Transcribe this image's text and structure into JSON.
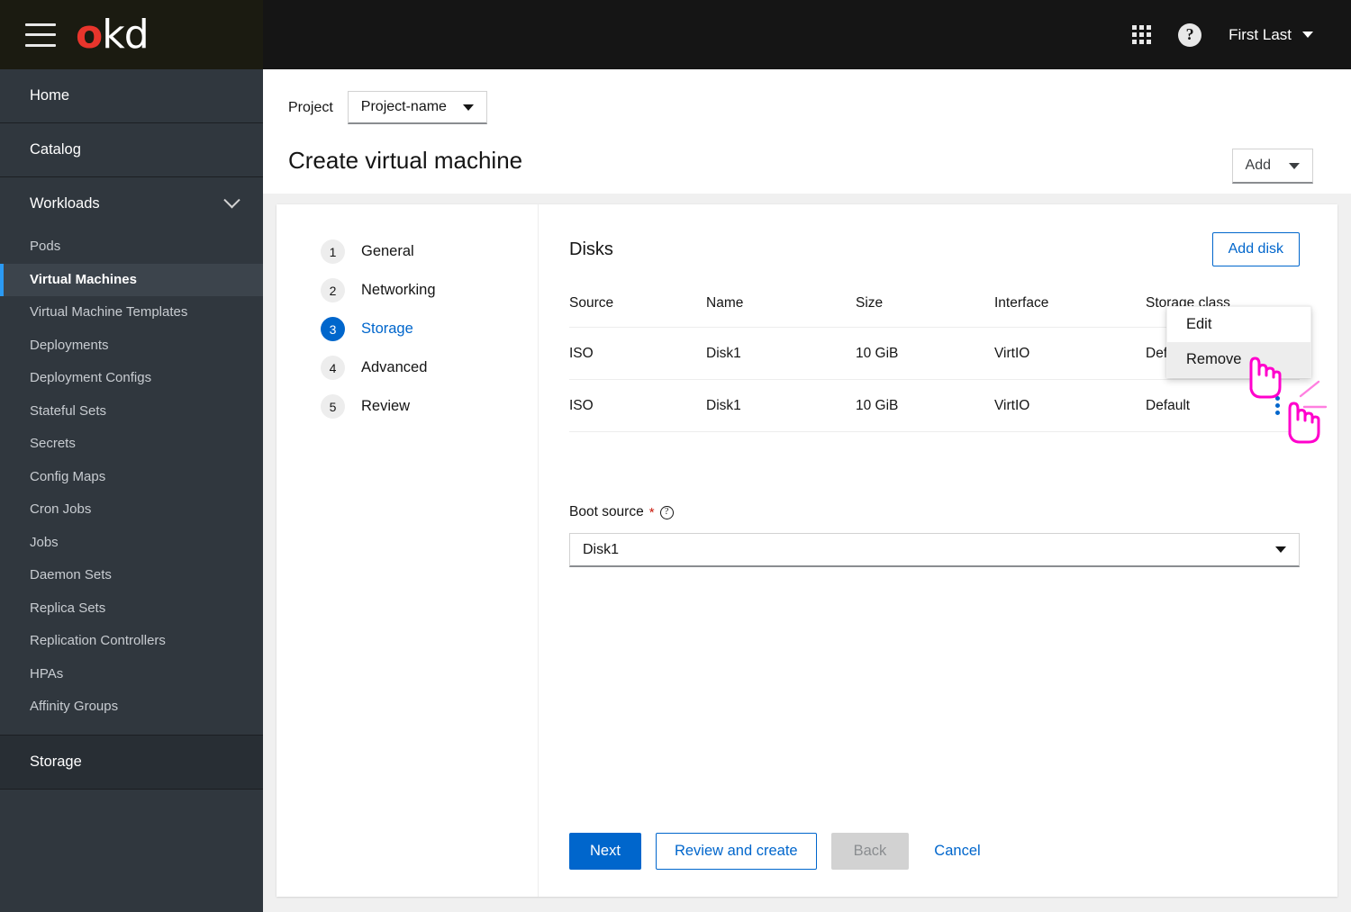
{
  "masthead": {
    "logo_o": "o",
    "logo_kd": "kd",
    "hamburger_icon": "hamburger-menu-icon",
    "apps_icon": "grid-apps-icon",
    "help_icon": "question-circle-icon",
    "user_name": "First Last",
    "user_caret_icon": "caret-down-icon"
  },
  "sidebar": {
    "sections": [
      {
        "label": "Home",
        "expandable": false,
        "items": []
      },
      {
        "label": "Catalog",
        "expandable": false,
        "items": []
      },
      {
        "label": "Workloads",
        "expandable": true,
        "chevron_icon": "chevron-down-icon",
        "items": [
          {
            "label": "Pods",
            "active": false
          },
          {
            "label": "Virtual Machines",
            "active": true
          },
          {
            "label": "Virtual Machine Templates",
            "active": false
          },
          {
            "label": "Deployments",
            "active": false
          },
          {
            "label": "Deployment Configs",
            "active": false
          },
          {
            "label": "Stateful Sets",
            "active": false
          },
          {
            "label": "Secrets",
            "active": false
          },
          {
            "label": "Config Maps",
            "active": false
          },
          {
            "label": "Cron Jobs",
            "active": false
          },
          {
            "label": "Jobs",
            "active": false
          },
          {
            "label": "Daemon Sets",
            "active": false
          },
          {
            "label": "Replica Sets",
            "active": false
          },
          {
            "label": "Replication Controllers",
            "active": false
          },
          {
            "label": "HPAs",
            "active": false
          },
          {
            "label": "Affinity Groups",
            "active": false
          }
        ]
      },
      {
        "label": "Storage",
        "expandable": false,
        "items": []
      }
    ]
  },
  "page_header": {
    "project_label": "Project",
    "project_value": "Project-name",
    "project_caret_icon": "caret-down-icon",
    "add_label": "Add",
    "add_caret_icon": "caret-down-icon",
    "title": "Create virtual machine"
  },
  "wizard": {
    "steps": [
      {
        "num": "1",
        "label": "General",
        "active": false
      },
      {
        "num": "2",
        "label": "Networking",
        "active": false
      },
      {
        "num": "3",
        "label": "Storage",
        "active": true
      },
      {
        "num": "4",
        "label": "Advanced",
        "active": false
      },
      {
        "num": "5",
        "label": "Review",
        "active": false
      }
    ]
  },
  "disks": {
    "title": "Disks",
    "add_disk_label": "Add disk",
    "columns": [
      "Source",
      "Name",
      "Size",
      "Interface",
      "Storage class"
    ],
    "rows": [
      {
        "source": "ISO",
        "name": "Disk1",
        "size": "10 GiB",
        "interface": "VirtIO",
        "storage_class": "Default",
        "kebab_icon": "kebab-menu-icon"
      },
      {
        "source": "ISO",
        "name": "Disk1",
        "size": "10 GiB",
        "interface": "VirtIO",
        "storage_class": "Default",
        "kebab_icon": "kebab-menu-icon"
      }
    ]
  },
  "dropdown_menu": {
    "items": [
      {
        "label": "Edit",
        "hovered": false
      },
      {
        "label": "Remove",
        "hovered": true
      }
    ]
  },
  "boot_source": {
    "label": "Boot source",
    "required_marker": "*",
    "help_icon": "question-circle-icon",
    "value": "Disk1",
    "caret_icon": "caret-down-icon"
  },
  "footer": {
    "next_label": "Next",
    "review_label": "Review and create",
    "back_label": "Back",
    "cancel_label": "Cancel"
  },
  "annotations": {
    "cursor_icon": "pointer-hand-cursor",
    "click_burst_icon": "click-burst-icon",
    "accent_color": "#ff00cc"
  },
  "colors": {
    "masthead_bg": "#151515",
    "sidebar_bg": "#30373e",
    "sidebar_active_bg": "#3c444c",
    "active_accent": "#2b9af3",
    "primary_blue": "#0066cc",
    "logo_red": "#e8352c",
    "required_red": "#c9190b",
    "content_bg": "#f0f0f0"
  }
}
